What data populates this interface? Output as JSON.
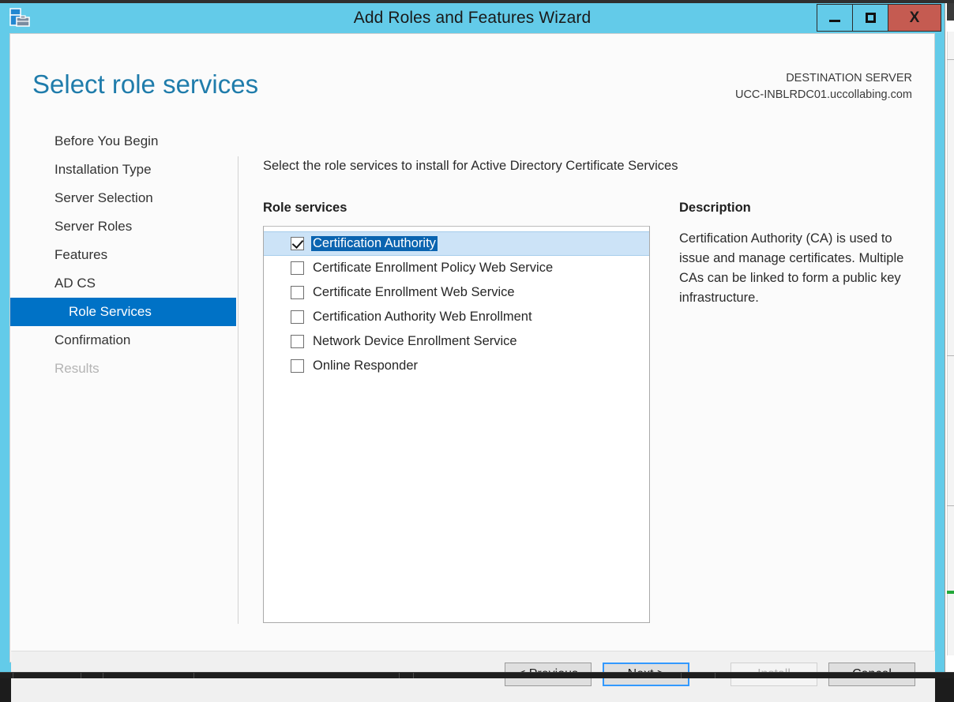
{
  "window": {
    "title": "Add Roles and Features Wizard",
    "icon": "server-manager-icon",
    "controls": {
      "minimize": "–",
      "maximize": "□",
      "close": "X"
    }
  },
  "header": {
    "page_title": "Select role services",
    "destination_label": "DESTINATION SERVER",
    "destination_server": "UCC-INBLRDC01.uccollabing.com"
  },
  "nav": {
    "items": [
      {
        "label": "Before You Begin",
        "state": "normal"
      },
      {
        "label": "Installation Type",
        "state": "normal"
      },
      {
        "label": "Server Selection",
        "state": "normal"
      },
      {
        "label": "Server Roles",
        "state": "normal"
      },
      {
        "label": "Features",
        "state": "normal"
      },
      {
        "label": "AD CS",
        "state": "normal"
      },
      {
        "label": "Role Services",
        "state": "active"
      },
      {
        "label": "Confirmation",
        "state": "normal"
      },
      {
        "label": "Results",
        "state": "disabled"
      }
    ]
  },
  "main": {
    "instruction": "Select the role services to install for Active Directory Certificate Services",
    "section_label": "Role services",
    "role_services": [
      {
        "label": "Certification Authority",
        "checked": true,
        "selected": true
      },
      {
        "label": "Certificate Enrollment Policy Web Service",
        "checked": false,
        "selected": false
      },
      {
        "label": "Certificate Enrollment Web Service",
        "checked": false,
        "selected": false
      },
      {
        "label": "Certification Authority Web Enrollment",
        "checked": false,
        "selected": false
      },
      {
        "label": "Network Device Enrollment Service",
        "checked": false,
        "selected": false
      },
      {
        "label": "Online Responder",
        "checked": false,
        "selected": false
      }
    ]
  },
  "description": {
    "label": "Description",
    "text": "Certification Authority (CA) is used to issue and manage certificates. Multiple CAs can be linked to form a public key infrastructure."
  },
  "footer": {
    "previous": "< Previous",
    "next": "Next >",
    "install": "Install",
    "cancel": "Cancel"
  },
  "colors": {
    "titlebar": "#63cbe9",
    "close_button": "#c55b51",
    "accent_heading": "#1f7cab",
    "nav_active": "#0072c6",
    "selection_row": "#cce3f7",
    "selection_text": "#0a64b0",
    "focus_outline": "#3399ff"
  }
}
